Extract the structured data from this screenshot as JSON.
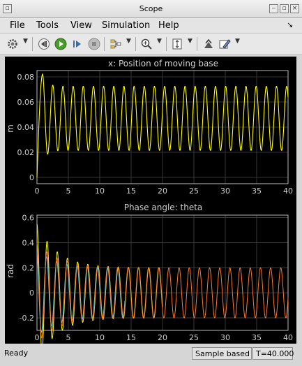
{
  "window": {
    "title": "Scope"
  },
  "menu": [
    {
      "label": "File"
    },
    {
      "label": "Tools"
    },
    {
      "label": "View"
    },
    {
      "label": "Simulation"
    },
    {
      "label": "Help"
    }
  ],
  "toolbar": {
    "icons": [
      "settings-icon",
      "step-back-icon",
      "run-icon",
      "step-forward-icon",
      "stop-icon",
      "highlight-icon",
      "zoom-icon",
      "autoscale-icon",
      "restore-icon",
      "style-icon"
    ]
  },
  "plots": {
    "top": {
      "title": "x: Position of moving base",
      "ylabel": "m",
      "yticks": [
        "0",
        "0.02",
        "0.04",
        "0.06",
        "0.08"
      ],
      "xticks": [
        "0",
        "5",
        "10",
        "15",
        "20",
        "25",
        "30",
        "35",
        "40"
      ]
    },
    "bottom": {
      "title": "Phase angle: theta",
      "ylabel": "rad",
      "yticks": [
        "-0.2",
        "0",
        "0.2",
        "0.4",
        "0.6"
      ],
      "xticks": [
        "0",
        "5",
        "10",
        "15",
        "20",
        "25",
        "30",
        "35",
        "40"
      ]
    }
  },
  "colors": {
    "background": "#000000",
    "grid": "#444444",
    "axes_box": "#b8b8b8",
    "tick_text": "#cfcfcf",
    "series_yellow": "#ffff00",
    "series_cyan": "#44ccff",
    "series_orange": "#ff7733"
  },
  "chart_data": [
    {
      "type": "line",
      "title": "x: Position of moving base",
      "xlabel": "",
      "ylabel": "m",
      "xlim": [
        0,
        40
      ],
      "ylim": [
        -0.005,
        0.085
      ],
      "grid": true,
      "series": [
        {
          "color": "#ffff00",
          "equation": "0.047 + 0.0255*sin(2*pi*t/1.62 - 0.9), starting near 0 at t=0, peak ~0.082 at t~1",
          "x_range": [
            0,
            40
          ]
        }
      ]
    },
    {
      "type": "line",
      "title": "Phase angle: theta",
      "xlabel": "",
      "ylabel": "rad",
      "xlim": [
        0,
        40
      ],
      "ylim": [
        -0.3,
        0.62
      ],
      "grid": true,
      "series": [
        {
          "color": "#ffff00",
          "start_value": 0.55,
          "steady_amplitude": 0.2,
          "x_range": [
            0,
            20
          ]
        },
        {
          "color": "#44ccff",
          "start_value": 0.35,
          "steady_amplitude": 0.2,
          "x_range": [
            0,
            14
          ]
        },
        {
          "color": "#ff7733",
          "start_value": 0.4,
          "steady_amplitude": 0.2,
          "x_range": [
            0,
            40
          ]
        }
      ]
    }
  ],
  "status": {
    "left": "Ready",
    "mode": "Sample based",
    "time": "T=40.000"
  }
}
